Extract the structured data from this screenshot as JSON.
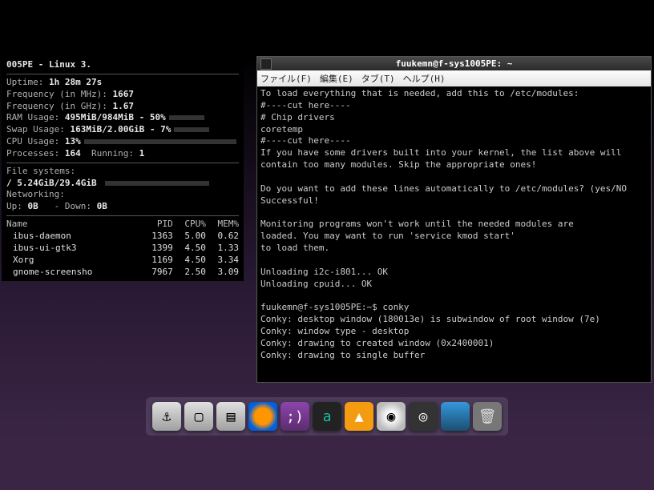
{
  "conky": {
    "title": "005PE - Linux 3.",
    "uptime_label": "Uptime:",
    "uptime_value": "1h 28m 27s",
    "freq_mhz_label": "Frequency (in MHz):",
    "freq_mhz_value": "1667",
    "freq_ghz_label": "Frequency (in GHz):",
    "freq_ghz_value": "1.67",
    "ram_label": "RAM Usage:",
    "ram_value": "495MiB/984MiB - 50%",
    "ram_pct": 50,
    "swap_label": "Swap Usage:",
    "swap_value": "163MiB/2.00GiB - 7%",
    "swap_pct": 7,
    "cpu_label": "CPU Usage:",
    "cpu_value": "13%",
    "cpu_pct": 13,
    "proc_label": "Processes:",
    "proc_value": "164",
    "running_label": "Running:",
    "running_value": "1",
    "fs_header": "File systems:",
    "fs_root": "/ 5.24GiB/29.4GiB",
    "fs_root_pct": 18,
    "net_header": "Networking:",
    "net_up_label": "Up:",
    "net_up_value": "0B",
    "net_down_label": "- Down:",
    "net_down_value": "0B",
    "proc_headers": {
      "name": "Name",
      "pid": "PID",
      "cpu": "CPU%",
      "mem": "MEM%"
    },
    "processes": [
      {
        "name": "ibus-daemon",
        "pid": "1363",
        "cpu": "5.00",
        "mem": "0.62"
      },
      {
        "name": "ibus-ui-gtk3",
        "pid": "1399",
        "cpu": "4.50",
        "mem": "1.33"
      },
      {
        "name": "Xorg",
        "pid": "1169",
        "cpu": "4.50",
        "mem": "3.34"
      },
      {
        "name": "gnome-screensho",
        "pid": "7967",
        "cpu": "2.50",
        "mem": "3.09"
      }
    ]
  },
  "terminal": {
    "title": "fuukemn@f-sys1005PE: ~",
    "menu": {
      "file": "ファイル(F)",
      "edit": "編集(E)",
      "tabs": "タブ(T)",
      "help": "ヘルプ(H)"
    },
    "lines": [
      "To load everything that is needed, add this to /etc/modules:",
      "#----cut here----",
      "# Chip drivers",
      "coretemp",
      "#----cut here----",
      "If you have some drivers built into your kernel, the list above will",
      "contain too many modules. Skip the appropriate ones!",
      "",
      "Do you want to add these lines automatically to /etc/modules? (yes/NO",
      "Successful!",
      "",
      "Monitoring programs won't work until the needed modules are",
      "loaded. You may want to run 'service kmod start'",
      "to load them.",
      "",
      "Unloading i2c-i801... OK",
      "Unloading cpuid... OK",
      "",
      "fuukemn@f-sys1005PE:~$ conky",
      "Conky: desktop window (180013e) is subwindow of root window (7e)",
      "Conky: window type - desktop",
      "Conky: drawing to created window (0x2400001)",
      "Conky: drawing to single buffer"
    ]
  },
  "dock": {
    "items": [
      {
        "name": "anchor",
        "glyph": "⚓"
      },
      {
        "name": "terminal",
        "glyph": "▢"
      },
      {
        "name": "files",
        "glyph": "▤"
      },
      {
        "name": "firefox",
        "glyph": ""
      },
      {
        "name": "pidgin",
        "glyph": ";)"
      },
      {
        "name": "amarok",
        "glyph": "a"
      },
      {
        "name": "vlc",
        "glyph": "▲"
      },
      {
        "name": "disc",
        "glyph": "◉"
      },
      {
        "name": "camera",
        "glyph": "◎"
      },
      {
        "name": "desktop",
        "glyph": ""
      },
      {
        "name": "trash",
        "glyph": "🗑"
      }
    ]
  }
}
